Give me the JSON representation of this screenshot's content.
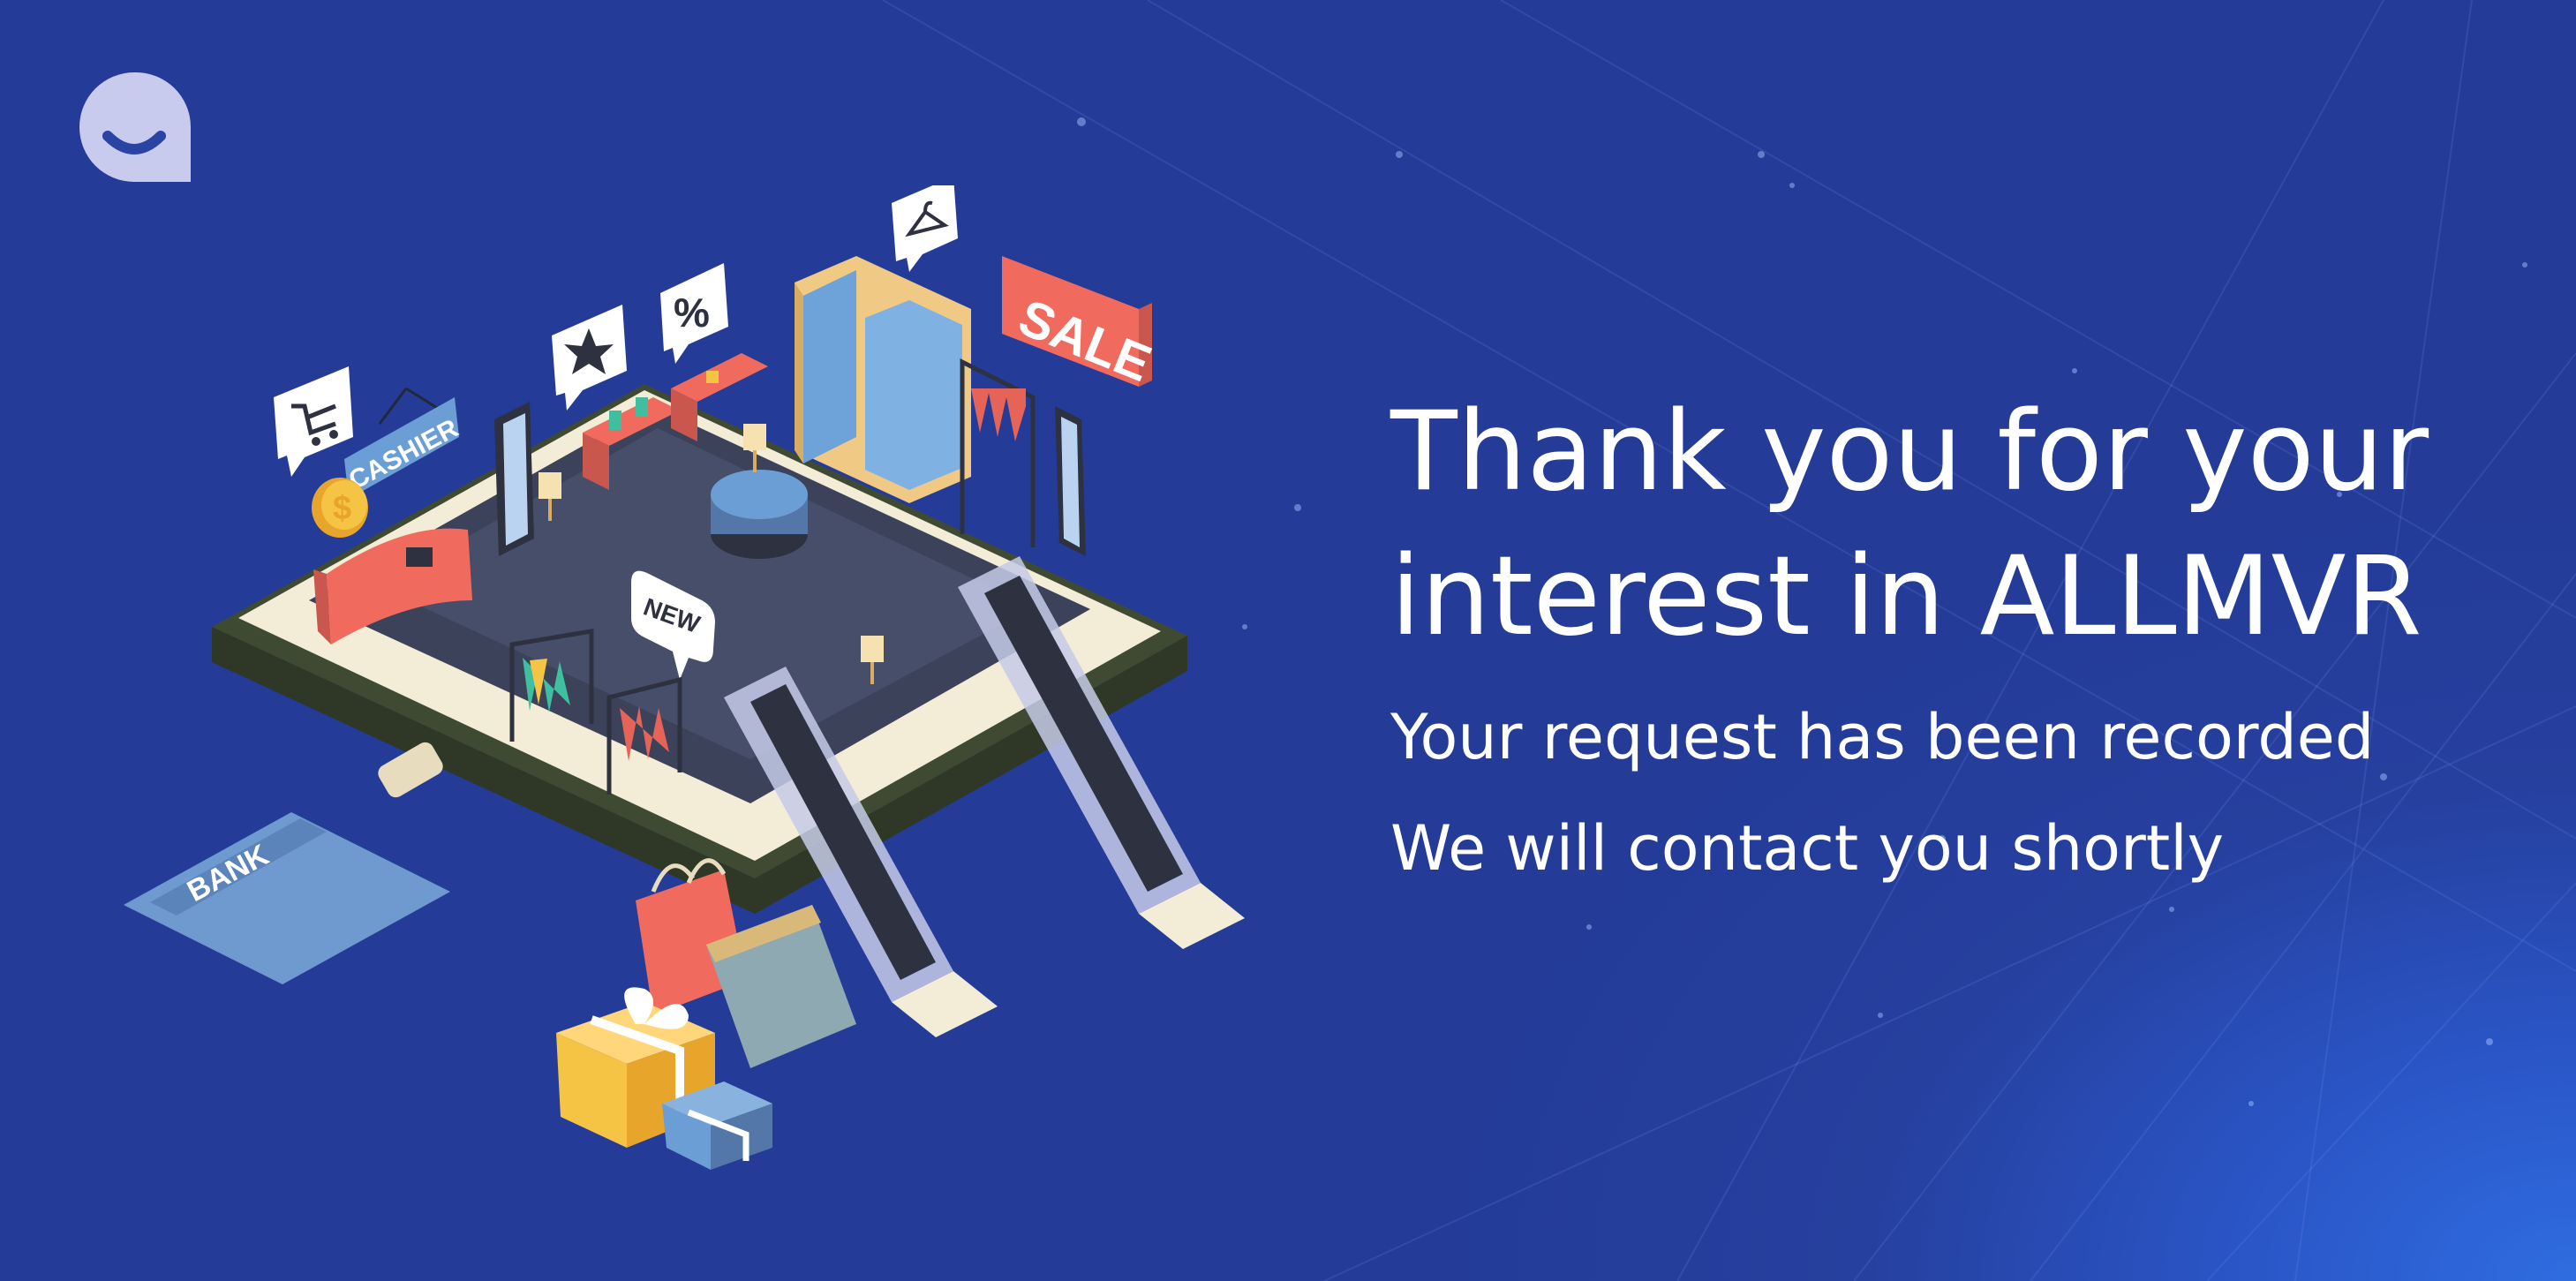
{
  "background": {
    "colors": [
      "#243b98",
      "#26409f",
      "#2f6de0"
    ]
  },
  "logo": {
    "icon": "smile-chat-icon",
    "color": "#c9cbee"
  },
  "illustration": {
    "icon": "isometric-shopping-mall-phone",
    "labels": {
      "sale_sign": "SALE",
      "cashier_sign": "CASHIER",
      "new_tag": "NEW",
      "bank_card": "BANK",
      "percent": "%",
      "coin": "$"
    }
  },
  "message": {
    "headline_line1": "Thank you for your",
    "headline_line2": "interest in ALLMVR",
    "subline1": "Your request has been recorded",
    "subline2": "We will contact you shortly"
  }
}
